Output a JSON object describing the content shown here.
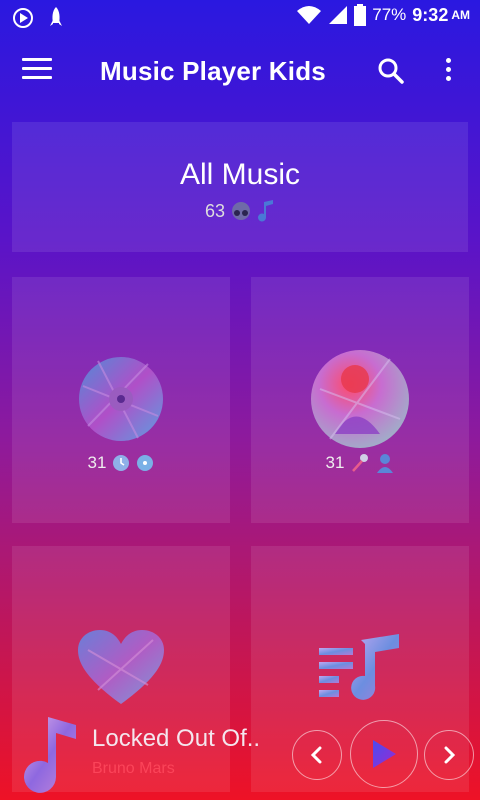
{
  "status_bar": {
    "battery": "77%",
    "time": "9:32",
    "ampm": "AM",
    "icons": [
      "media-play-icon",
      "rocket-icon",
      "wifi-icon",
      "signal-icon",
      "battery-icon"
    ]
  },
  "app_bar": {
    "title": "Music Player Kids",
    "icons": [
      "menu-icon",
      "search-icon",
      "more-vert-icon"
    ]
  },
  "all_music": {
    "title": "All Music",
    "count": "63",
    "icons": [
      "headphones-icon",
      "music-note-icon"
    ]
  },
  "tiles": [
    {
      "name": "albums",
      "count": "31",
      "icons": [
        "clock-icon",
        "disc-icon"
      ]
    },
    {
      "name": "artists",
      "count": "31",
      "icons": [
        "microphone-icon",
        "person-icon"
      ]
    },
    {
      "name": "favorites",
      "count": "",
      "icons": [
        "heart-icon"
      ]
    },
    {
      "name": "playlists",
      "count": "",
      "icons": [
        "playlist-icon"
      ]
    }
  ],
  "now_playing": {
    "title": "Locked Out Of..",
    "artist": "Bruno Mars",
    "controls": [
      "previous-icon",
      "play-icon",
      "next-icon"
    ]
  },
  "colors": {
    "gradient_top": "#2a18e0",
    "gradient_bottom": "#ee1226",
    "play_accent": "#7a2cff"
  }
}
